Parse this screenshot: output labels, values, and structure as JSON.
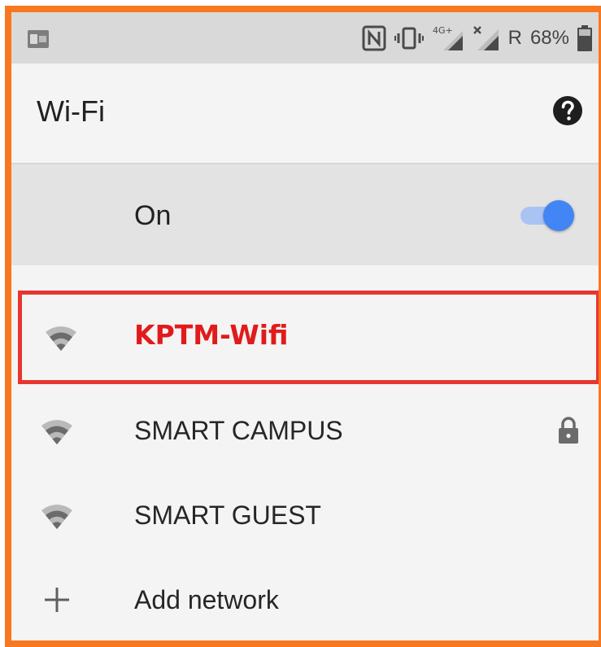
{
  "status_bar": {
    "notification_icon": "outlook-icon",
    "network_type": "4G+",
    "roaming": "R",
    "battery": "68%",
    "icons": [
      "nfc-icon",
      "vibrate-icon",
      "signal-4g-icon",
      "signal-no-sim-icon",
      "battery-icon"
    ]
  },
  "header": {
    "title": "Wi-Fi",
    "help_icon": "help-icon"
  },
  "master_switch": {
    "label": "On",
    "enabled": true,
    "accent_color": "#4285f4"
  },
  "networks": [
    {
      "name": "KPTM-Wifi",
      "icon": "wifi-signal-icon",
      "secured": false,
      "highlighted": true,
      "highlight_color": "#e8352f",
      "text_color": "#e11b1b"
    },
    {
      "name": "SMART CAMPUS",
      "icon": "wifi-signal-icon",
      "secured": true,
      "highlighted": false
    },
    {
      "name": "SMART GUEST",
      "icon": "wifi-signal-icon",
      "secured": false,
      "highlighted": false
    }
  ],
  "add_network": {
    "label": "Add network",
    "icon": "plus-icon"
  },
  "colors": {
    "frame_border": "#f7781e",
    "status_bar_bg": "#d9d9d9",
    "background": "#f4f4f4"
  }
}
